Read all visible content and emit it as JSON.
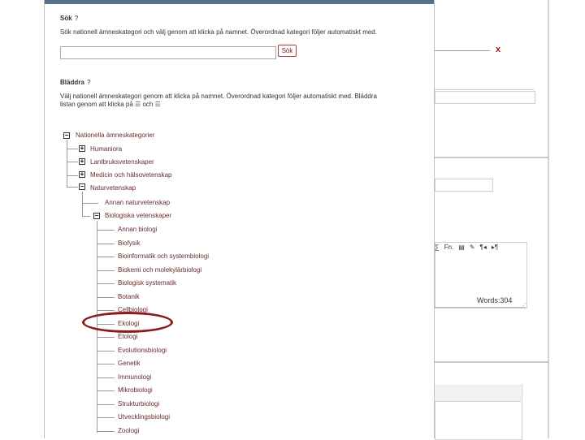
{
  "search": {
    "title": "Sök",
    "help": "?",
    "description": "Sök nationell ämneskategori och välj genom att klicka på namnet. Överordnad kategori följer automatiskt med.",
    "button_label": "Sök",
    "value": ""
  },
  "browse": {
    "title": "Bläddra",
    "help": "?",
    "description_line1": "Välj nationell ämneskategori genom att klicka på namnet. Överordnad kategori följer automatiskt med. Bläddra",
    "description_line2": "listan genom att klicka på",
    "description_and": "och"
  },
  "tree": {
    "root": "Nationella ämneskategorier",
    "level1": [
      "Humaniora",
      "Lantbruksvetenskaper",
      "Medicin och hälsovetenskap",
      "Naturvetenskap"
    ],
    "natural_sciences": [
      "Annan naturvetenskap",
      "Biologiska vetenskaper"
    ],
    "biology": [
      "Annan biologi",
      "Biofysik",
      "Bioinformatik och systembiologi",
      "Biokemi och molekylärbiologi",
      "Biologisk systematik",
      "Botanik",
      "Cellbiologi",
      "Ekologi",
      "Etologi",
      "Evolutionsbiologi",
      "Genetik",
      "Immunologi",
      "Mikrobiologi",
      "Strukturbiologi",
      "Utvecklingsbiologi",
      "Zoologi"
    ]
  },
  "background": {
    "close_mark": "x",
    "words_count": "Words:304",
    "toolbar": [
      "∑",
      "Fn.",
      "▤",
      "✎",
      "¶◂",
      "▸¶"
    ]
  },
  "colors": {
    "link": "#6b2a2a",
    "highlight_ring": "#8b1a1a",
    "modal_bar": "#5a6f8c"
  }
}
